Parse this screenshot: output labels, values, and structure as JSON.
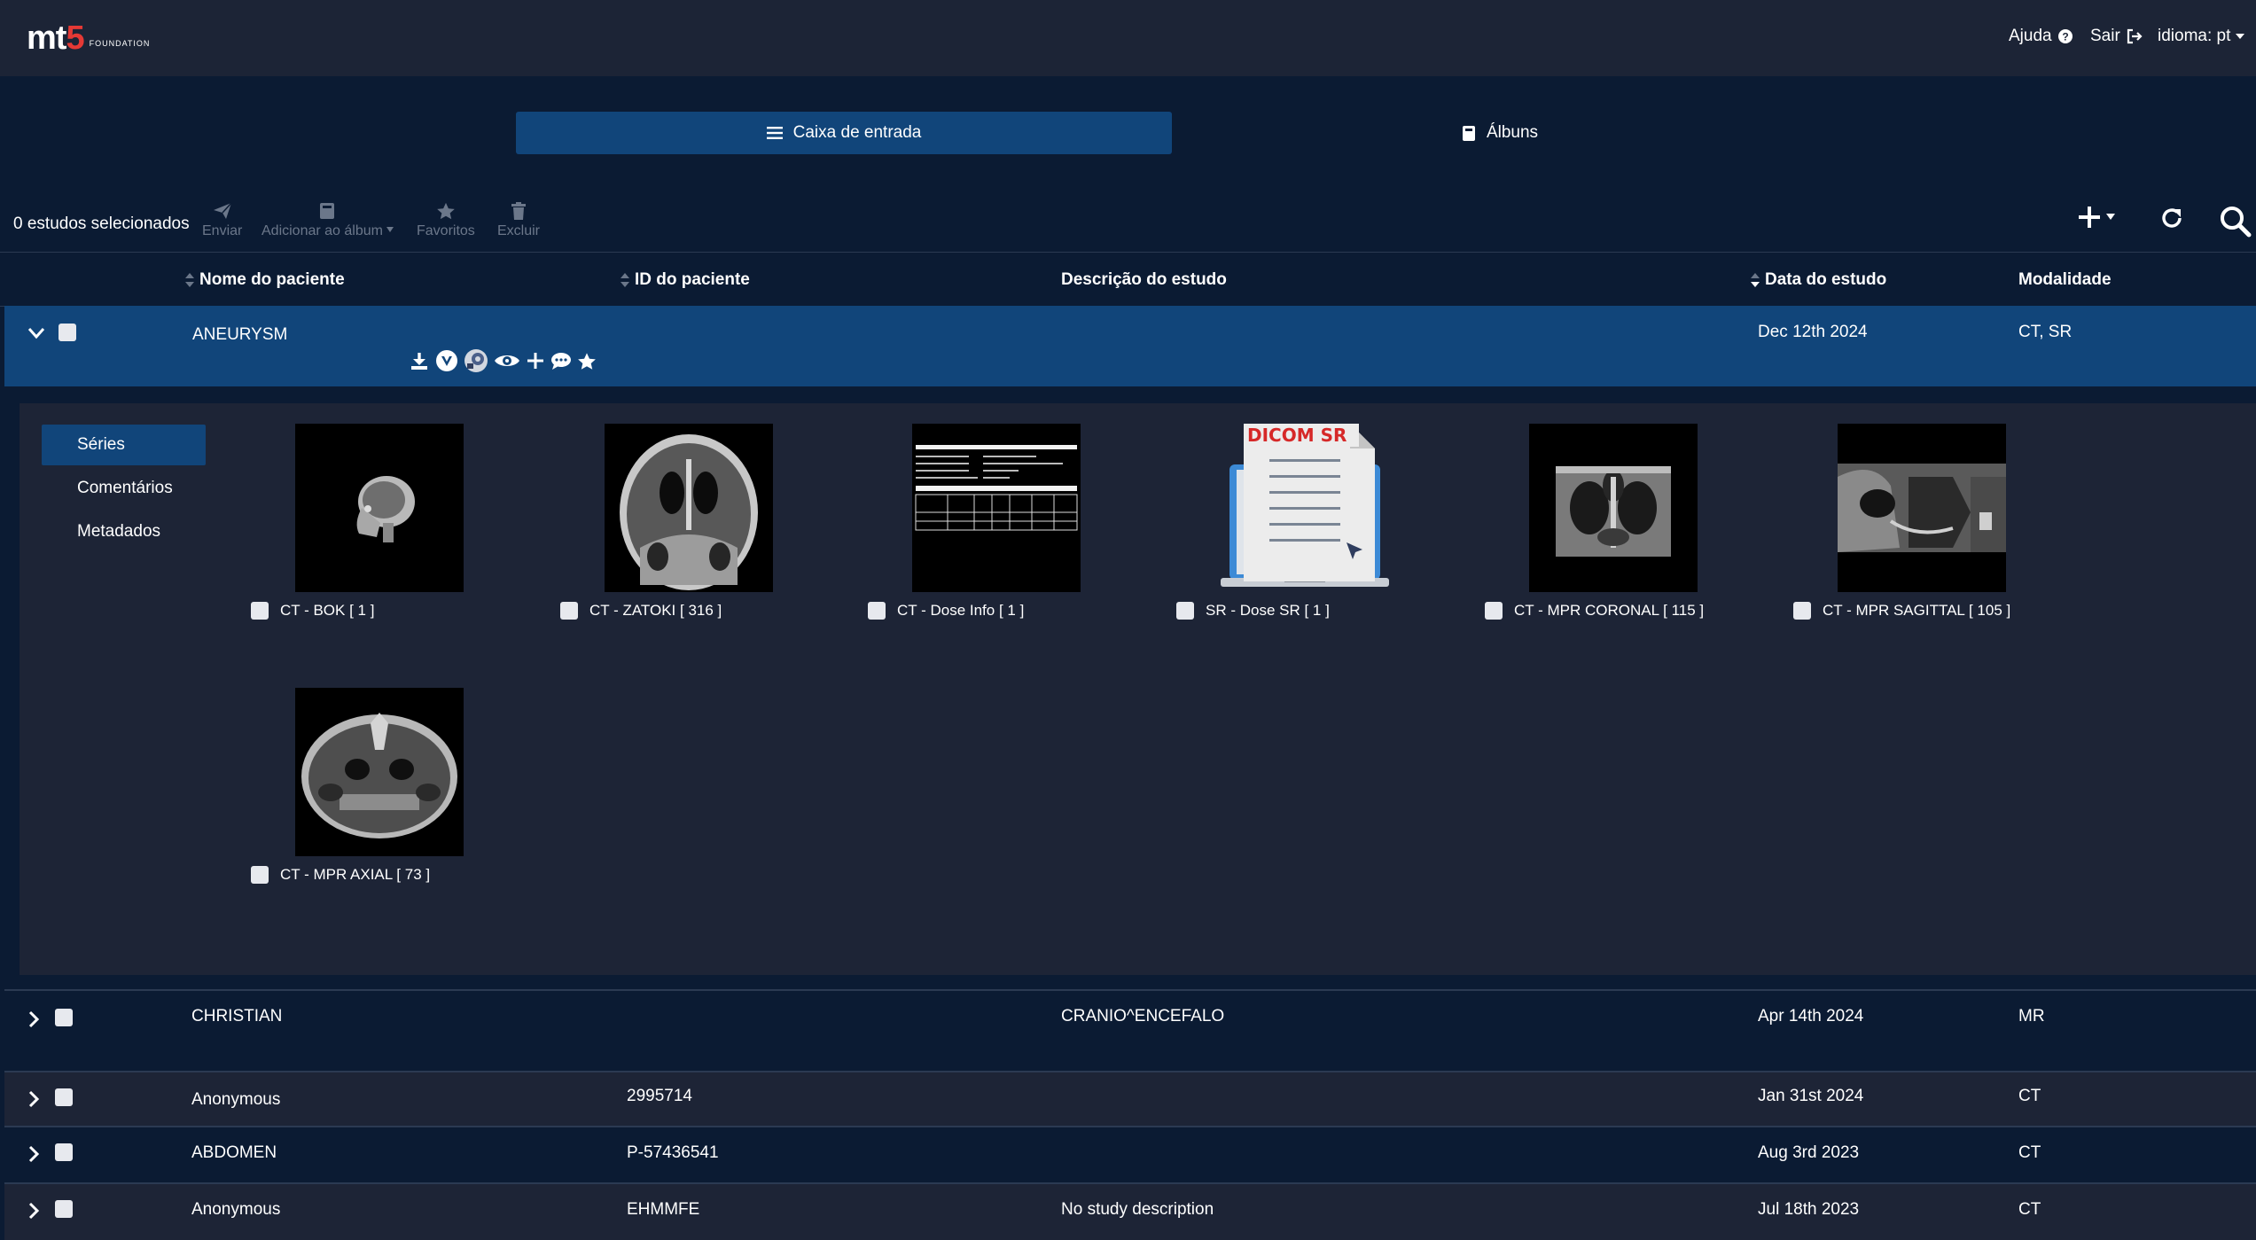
{
  "nav": {
    "logo_main_prefix": "mt",
    "logo_main_five": "5",
    "logo_sub": "FOUNDATION",
    "help": "Ajuda",
    "logout": "Sair",
    "language": "idioma: pt"
  },
  "tabs": {
    "inbox": "Caixa de entrada",
    "albums": "Álbuns"
  },
  "toolbar": {
    "selected": "0 estudos selecionados",
    "send": "Enviar",
    "add_album": "Adicionar ao álbum",
    "favorites": "Favoritos",
    "delete": "Excluir"
  },
  "columns": {
    "patient_name": "Nome do paciente",
    "patient_id": "ID do paciente",
    "study_desc": "Descrição do estudo",
    "study_date": "Data do estudo",
    "modality": "Modalidade"
  },
  "expanded": {
    "name": "ANEURYSM",
    "patient_id": "",
    "description": "",
    "date": "Dec 12th 2024",
    "modality": "CT, SR",
    "menu": {
      "series": "Séries",
      "comments": "Comentários",
      "metadata": "Metadados"
    },
    "series": [
      {
        "label": "CT - BOK [ 1 ]"
      },
      {
        "label": "CT - ZATOKI [ 316 ]"
      },
      {
        "label": "CT - Dose Info [ 1 ]"
      },
      {
        "label": "SR - Dose SR [ 1 ]",
        "badge": "DICOM SR"
      },
      {
        "label": "CT - MPR CORONAL [ 115 ]"
      },
      {
        "label": "CT - MPR SAGITTAL [ 105 ]"
      },
      {
        "label": "CT - MPR AXIAL [ 73 ]"
      }
    ]
  },
  "studies": [
    {
      "name": "CHRISTIAN",
      "patient_id": "",
      "description": "CRANIO^ENCEFALO",
      "date": "Apr 14th 2024",
      "modality": "MR"
    },
    {
      "name": "Anonymous",
      "patient_id": "2995714",
      "description": "",
      "date": "Jan 31st 2024",
      "modality": "CT"
    },
    {
      "name": "ABDOMEN",
      "patient_id": "P-57436541",
      "description": "",
      "date": "Aug 3rd 2023",
      "modality": "CT"
    },
    {
      "name": "Anonymous",
      "patient_id": "EHMMFE",
      "description": "No study description",
      "date": "Jul 18th 2023",
      "modality": "CT"
    }
  ],
  "colors": {
    "background": "#0b1b33",
    "topbar": "#1c2436",
    "accent": "#11457a",
    "panel": "#1d2436",
    "muted": "#6b778a"
  }
}
